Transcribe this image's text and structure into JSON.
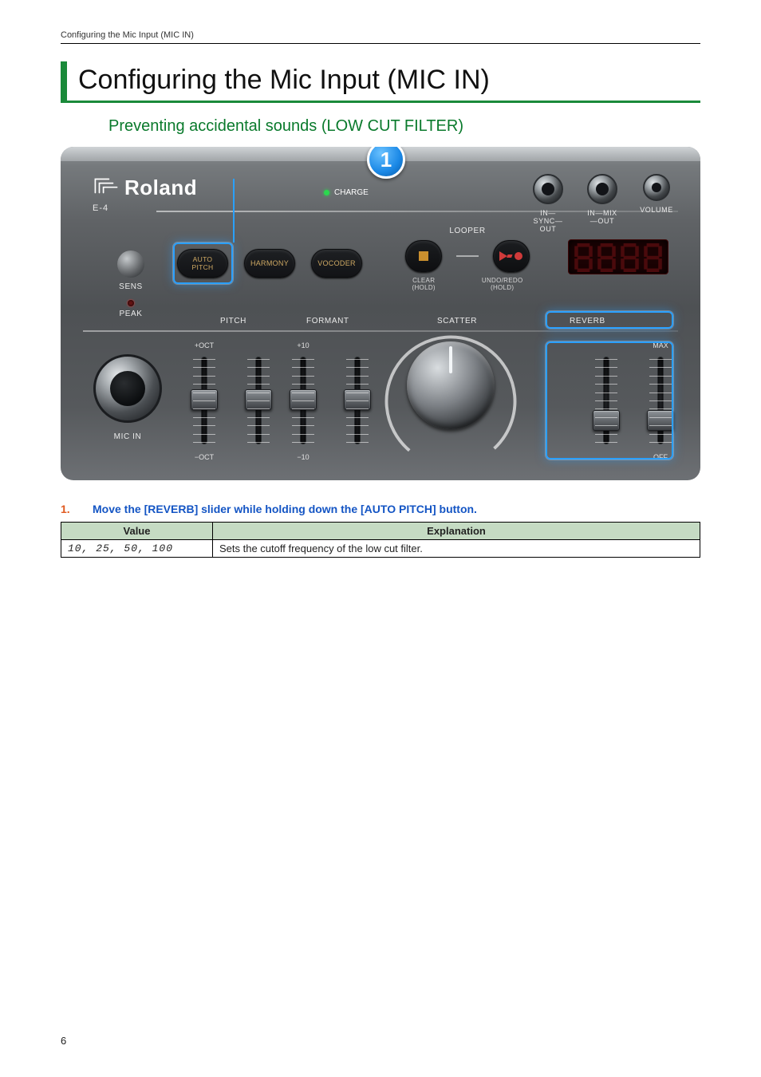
{
  "running_head": "Configuring the Mic Input (MIC IN)",
  "h1": "Configuring the Mic Input (MIC IN)",
  "h2": "Preventing accidental sounds (LOW CUT FILTER)",
  "callout_number": "1",
  "panel": {
    "brand": "Roland",
    "model": "E-4",
    "charge_label": "CHARGE",
    "jacks": {
      "in_sync_out": "IN—SYNC—OUT",
      "in_mix_out": "IN—MIX—OUT",
      "volume": "VOLUME"
    },
    "sens_label": "SENS",
    "peak_label": "PEAK",
    "fx": {
      "auto_pitch_l1": "AUTO",
      "auto_pitch_l2": "PITCH",
      "harmony": "HARMONY",
      "vocoder": "VOCODER"
    },
    "looper": {
      "title": "LOOPER",
      "clear_l1": "CLEAR",
      "clear_l2": "(HOLD)",
      "undo_l1": "UNDO/REDO",
      "undo_l2": "(HOLD)"
    },
    "row2": {
      "pitch": "PITCH",
      "formant": "FORMANT",
      "scatter": "SCATTER",
      "reverb": "REVERB"
    },
    "sliders": {
      "pitch_top": "+OCT",
      "pitch_bot": "−OCT",
      "formant_top": "+10",
      "formant_bot": "−10",
      "reverb_top": "MAX",
      "reverb_bot": "OFF"
    },
    "mic_in": "MIC IN"
  },
  "step": {
    "num": "1.",
    "text": "Move the [REVERB] slider while holding down the [AUTO PITCH] button."
  },
  "table": {
    "head_value": "Value",
    "head_explanation": "Explanation",
    "row_value": "10, 25, 50, 100",
    "row_explanation": "Sets the cutoff frequency of the low cut filter."
  },
  "page_number": "6"
}
